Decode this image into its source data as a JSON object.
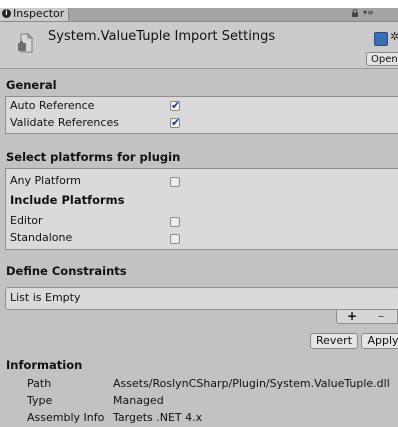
{
  "tab": {
    "label": "Inspector"
  },
  "header": {
    "title": "System.ValueTuple Import Settings",
    "open_label": "Open"
  },
  "general": {
    "title": "General",
    "rows": [
      {
        "label": "Auto Reference",
        "checked": true
      },
      {
        "label": "Validate References",
        "checked": true
      }
    ]
  },
  "platforms": {
    "title": "Select platforms for plugin",
    "any_platform": {
      "label": "Any Platform",
      "checked": false
    },
    "include_title": "Include Platforms",
    "rows": [
      {
        "label": "Editor",
        "checked": false
      },
      {
        "label": "Standalone",
        "checked": false
      }
    ]
  },
  "constraints": {
    "title": "Define Constraints",
    "empty_label": "List is Empty",
    "add_label": "+",
    "remove_label": "–"
  },
  "actions": {
    "revert_label": "Revert",
    "apply_label": "Apply"
  },
  "information": {
    "title": "Information",
    "rows": [
      {
        "label": "Path",
        "value": "Assets/RoslynCSharp/Plugin/System.ValueTuple.dll"
      },
      {
        "label": "Type",
        "value": "Managed"
      },
      {
        "label": "Assembly Info",
        "value": "Targets .NET 4.x"
      }
    ]
  },
  "colors": {
    "panel_bg": "#c2c2c2",
    "group_bg": "#dadada",
    "checkmark": "#1e3e6e"
  }
}
